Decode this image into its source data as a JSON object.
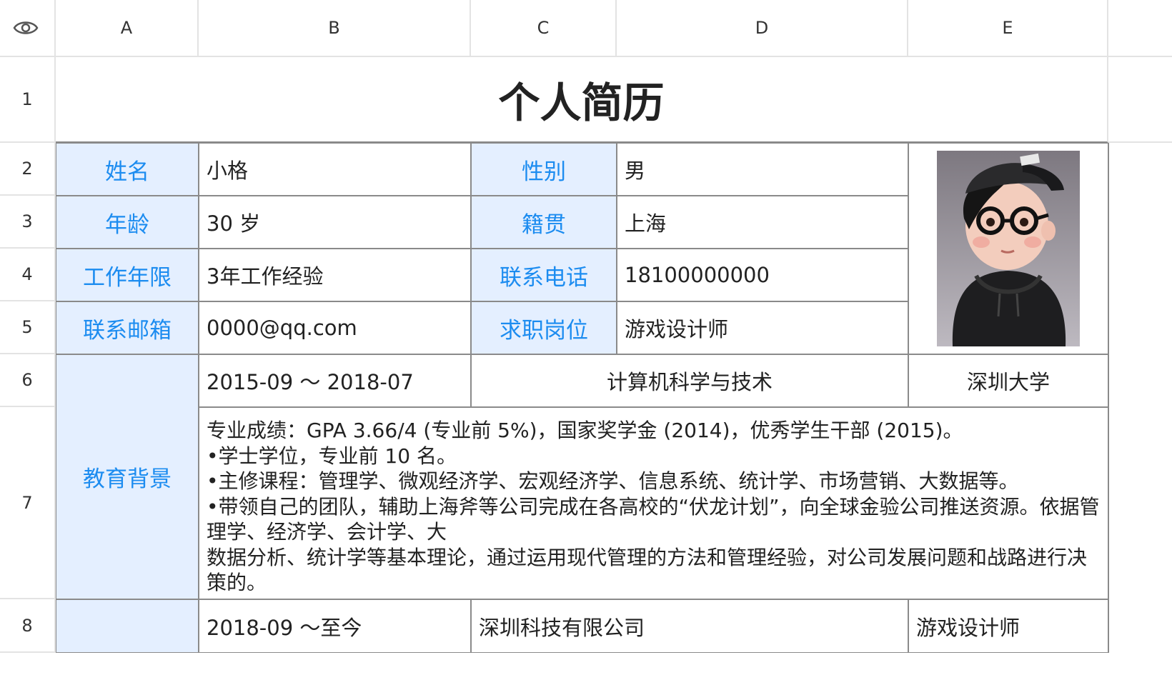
{
  "columns": [
    "A",
    "B",
    "C",
    "D",
    "E"
  ],
  "rows": [
    "1",
    "2",
    "3",
    "4",
    "5",
    "6",
    "7",
    "8"
  ],
  "title": "个人简历",
  "fields": {
    "name_label": "姓名",
    "name_value": "小格",
    "gender_label": "性别",
    "gender_value": "男",
    "age_label": "年龄",
    "age_value": "30 岁",
    "hometown_label": "籍贯",
    "hometown_value": "上海",
    "years_label": "工作年限",
    "years_value": "3年工作经验",
    "phone_label": "联系电话",
    "phone_value": "18100000000",
    "email_label": "联系邮箱",
    "email_value": "0000@qq.com",
    "job_label": "求职岗位",
    "job_value": "游戏设计师"
  },
  "education": {
    "label": "教育背景",
    "period": "2015-09 ～ 2018-07",
    "major": "计算机科学与技术",
    "school": "深圳大学",
    "details": [
      "专业成绩：GPA 3.66/4 (专业前 5%)，国家奖学金 (2014)，优秀学生干部 (2015)。",
      "•学士学位，专业前 10 名。",
      "•主修课程：管理学、微观经济学、宏观经济学、信息系统、统计学、市场营销、大数据等。",
      "•带领自己的团队，辅助上海斧等公司完成在各高校的“伏龙计划”，向全球金验公司推送资源。依据管理学、经济学、会计学、大",
      "数据分析、统计学等基本理论，通过运用现代管理的方法和管理经验，对公司发展问题和战路进行决策的。"
    ]
  },
  "work": {
    "period": "2018-09 ～至今",
    "company": "深圳科技有限公司",
    "position": "游戏设计师"
  },
  "colors": {
    "label_bg": "#e4efff",
    "label_text": "#1c8cf0",
    "grid": "#e3e3e3",
    "border": "#8a8a8a"
  }
}
